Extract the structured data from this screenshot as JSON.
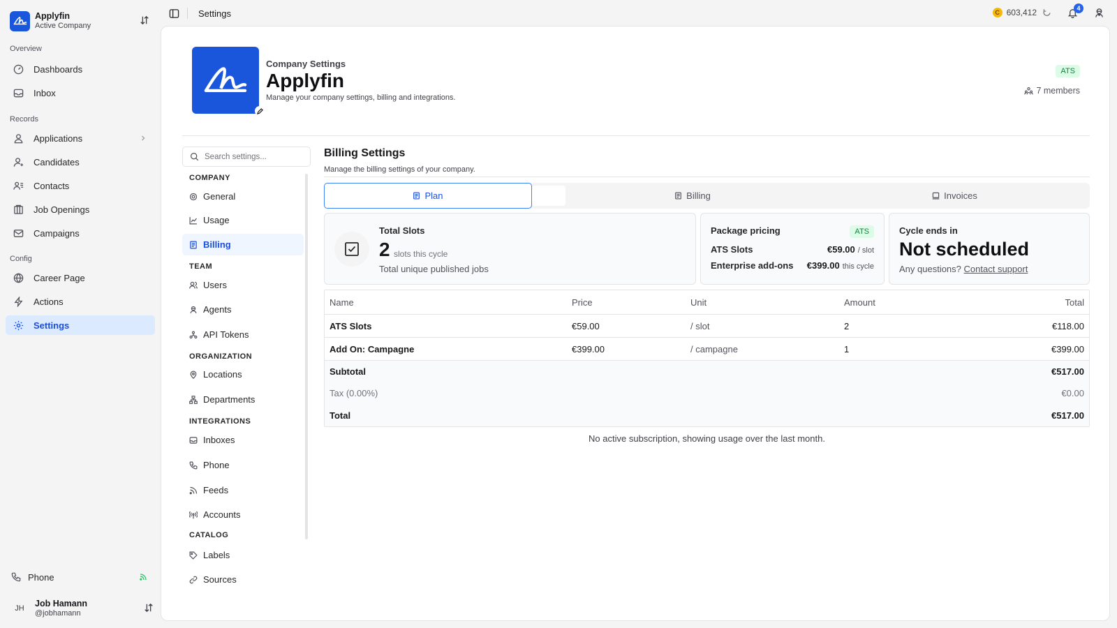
{
  "company": {
    "name": "Applyfin",
    "subtitle": "Active Company"
  },
  "nav": {
    "sections": {
      "overview": "Overview",
      "records": "Records",
      "config": "Config"
    },
    "items": [
      {
        "label": "Dashboards",
        "icon": "dashboard-icon"
      },
      {
        "label": "Inbox",
        "icon": "inbox-icon"
      },
      {
        "label": "Applications",
        "icon": "user-icon"
      },
      {
        "label": "Candidates",
        "icon": "candidate-icon"
      },
      {
        "label": "Contacts",
        "icon": "contacts-icon"
      },
      {
        "label": "Job Openings",
        "icon": "building-icon"
      },
      {
        "label": "Campaigns",
        "icon": "mail-icon"
      },
      {
        "label": "Career Page",
        "icon": "globe-icon"
      },
      {
        "label": "Actions",
        "icon": "bolt-icon"
      },
      {
        "label": "Settings",
        "icon": "gear-icon"
      }
    ],
    "phone": "Phone",
    "user": {
      "initials": "JH",
      "name": "Job Hamann",
      "handle": "@jobhamann"
    }
  },
  "topbar": {
    "title": "Settings",
    "credits": "603,412",
    "credits_symbol": "C",
    "notifications": "4"
  },
  "header": {
    "kicker": "Company Settings",
    "title": "Applyfin",
    "description": "Manage your company settings, billing and integrations.",
    "badge": "ATS",
    "members": "7 members"
  },
  "settings_nav": {
    "search_placeholder": "Search settings...",
    "sections": {
      "company": "COMPANY",
      "team": "TEAM",
      "organization": "ORGANIZATION",
      "integrations": "INTEGRATIONS",
      "catalog": "CATALOG"
    },
    "items": {
      "general": "General",
      "usage": "Usage",
      "billing": "Billing",
      "users": "Users",
      "agents": "Agents",
      "api_tokens": "API Tokens",
      "locations": "Locations",
      "departments": "Departments",
      "inboxes": "Inboxes",
      "phone": "Phone",
      "feeds": "Feeds",
      "accounts": "Accounts",
      "labels": "Labels",
      "sources": "Sources"
    }
  },
  "billing": {
    "title": "Billing Settings",
    "description": "Manage the billing settings of your company.",
    "tabs": [
      "Plan",
      "Billing",
      "Invoices"
    ],
    "total_slots": {
      "label": "Total Slots",
      "value": "2",
      "unit": "slots this cycle",
      "description": "Total unique published jobs"
    },
    "package": {
      "label": "Package pricing",
      "badge": "ATS",
      "rows": [
        {
          "name": "ATS Slots",
          "price": "€59.00",
          "unit": "/ slot"
        },
        {
          "name": "Enterprise add-ons",
          "price": "€399.00",
          "unit": "this cycle"
        }
      ]
    },
    "cycle": {
      "label": "Cycle ends in",
      "value": "Not scheduled",
      "question": "Any questions?",
      "link": "Contact support"
    },
    "table": {
      "headers": [
        "Name",
        "Price",
        "Unit",
        "Amount",
        "Total"
      ],
      "rows": [
        [
          "ATS Slots",
          "€59.00",
          "/ slot",
          "2",
          "€118.00"
        ],
        [
          "Add On: Campagne",
          "€399.00",
          "/ campagne",
          "1",
          "€399.00"
        ]
      ],
      "subtotal": {
        "label": "Subtotal",
        "value": "€517.00"
      },
      "tax": {
        "label": "Tax (0.00%)",
        "value": "€0.00"
      },
      "total": {
        "label": "Total",
        "value": "€517.00"
      }
    },
    "note": "No active subscription, showing usage over the last month."
  }
}
